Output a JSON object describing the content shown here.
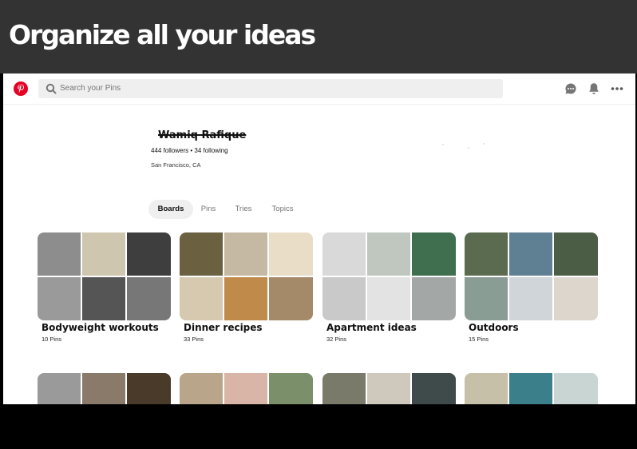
{
  "banner": {
    "headline": "Organize all your ideas",
    "background": "#333333"
  },
  "header": {
    "logo_icon": "pinterest-logo",
    "search_placeholder": "Search your Pins",
    "icons": [
      "message-icon",
      "bell-icon",
      "more-icon"
    ],
    "brand_color": "#e60023"
  },
  "profile": {
    "name": "Wamiq Rafique",
    "follow_stats": "444 followers • 34 following",
    "location": "San Francisco, CA"
  },
  "tabs": [
    {
      "label": "Boards",
      "active": true
    },
    {
      "label": "Pins",
      "active": false
    },
    {
      "label": "Tries",
      "active": false
    },
    {
      "label": "Topics",
      "active": false
    }
  ],
  "boards": [
    {
      "title": "Bodyweight workouts",
      "pins": "10 Pins",
      "colors": [
        "#8d8d8d",
        "#cfc6b0",
        "#6e5a45",
        "#9a9a9a",
        "#555",
        "#3e3e3e",
        "#777"
      ]
    },
    {
      "title": "Dinner recipes",
      "pins": "33 Pins",
      "colors": [
        "#6b6040",
        "#c6b9a4",
        "#7a8a5a",
        "#d7c9b0",
        "#c08a4a",
        "#e9ddc8",
        "#a58a6a"
      ]
    },
    {
      "title": "Apartment ideas",
      "pins": "32 Pins",
      "colors": [
        "#d9d9d9",
        "#bfc7bf",
        "#6e6e6e",
        "#c9c9c9",
        "#e3e3e3",
        "#3f6f4f",
        "#a3a8a6"
      ]
    },
    {
      "title": "Outdoors",
      "pins": "15 Pins",
      "colors": [
        "#5b6b4f",
        "#5f7f93",
        "#b06b3f",
        "#8a9d95",
        "#cfd5d8",
        "#4b5e45",
        "#dcd6cc"
      ]
    }
  ],
  "boards_row2": [
    {
      "colors": [
        "#9a9a9a",
        "#8a7a6a",
        "#4a3a2a"
      ]
    },
    {
      "colors": [
        "#b9a58a",
        "#d9b5a8",
        "#7a8f6a"
      ]
    },
    {
      "colors": [
        "#7a7a6a",
        "#cfc8bd",
        "#3f4a4a"
      ]
    },
    {
      "colors": [
        "#c7c0a8",
        "#3a7f8a",
        "#c9d5d2"
      ]
    }
  ]
}
